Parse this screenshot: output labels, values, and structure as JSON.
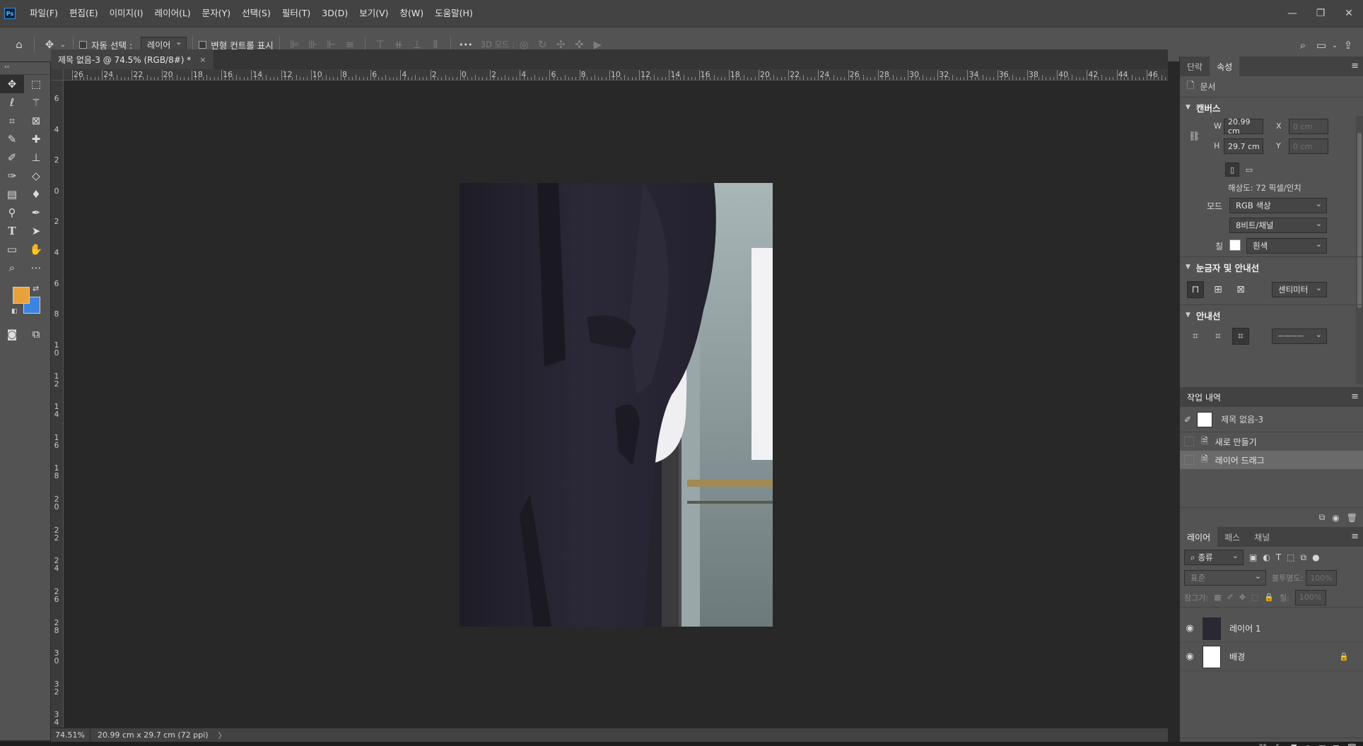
{
  "menubar": {
    "logo": "Ps",
    "items": [
      "파일(F)",
      "편집(E)",
      "이미지(I)",
      "레이어(L)",
      "문자(Y)",
      "선택(S)",
      "필터(T)",
      "3D(D)",
      "보기(V)",
      "창(W)",
      "도움말(H)"
    ],
    "window_controls": [
      "—",
      "❐",
      "✕"
    ]
  },
  "options": {
    "auto_select_label": "자동 선택 :",
    "auto_select_value": "레이어",
    "transform_label": "변형 컨트롤 표시",
    "more_label": "•••",
    "mode3d_label": "3D 모드 :"
  },
  "document": {
    "tab_title": "제목 없음-3 @ 74.5% (RGB/8#) *",
    "tab_close": "×",
    "image_note": ""
  },
  "ruler": {
    "h_labels": [
      "26",
      "24",
      "22",
      "20",
      "18",
      "16",
      "14",
      "12",
      "10",
      "8",
      "6",
      "4",
      "2",
      "0",
      "2",
      "4",
      "6",
      "8",
      "10",
      "12",
      "14",
      "16",
      "18",
      "20",
      "22",
      "24",
      "26",
      "28",
      "30",
      "32",
      "34",
      "36",
      "38",
      "40",
      "42",
      "44",
      "46"
    ],
    "v_labels": [
      "6",
      "4",
      "2",
      "0",
      "2",
      "4",
      "6",
      "8",
      "10",
      "12",
      "14",
      "16",
      "18",
      "20",
      "22",
      "24",
      "26",
      "28",
      "30",
      "32",
      "34"
    ]
  },
  "status": {
    "zoom": "74.51%",
    "info": "20.99 cm x 29.7 cm (72 ppi)",
    "arrow": "〉"
  },
  "properties": {
    "tabs": [
      "단락",
      "속성"
    ],
    "doc_label": "문서",
    "canvas_head": "캔버스",
    "w_label": "W",
    "w_value": "20.99 cm",
    "h_label": "H",
    "h_value": "29.7 cm",
    "x_label": "X",
    "x_placeholder": "0 cm",
    "y_label": "Y",
    "y_placeholder": "0 cm",
    "resolution": "해상도: 72 픽셀/인치",
    "mode_label": "모드",
    "mode_value": "RGB 색상",
    "depth_value": "8비트/채널",
    "fill_label": "칠",
    "fill_value": "흰색",
    "rulers_head": "눈금자 및 안내선",
    "units_value": "센티미터",
    "guides_head": "안내선",
    "guide_line_value": "————"
  },
  "history": {
    "tab": "작업 내역",
    "snapshot": "제목 없음-3",
    "items": [
      "새로 만들기",
      "레이어 드래그"
    ]
  },
  "layers": {
    "tabs": [
      "레이어",
      "패스",
      "채널"
    ],
    "filter_value": "종류",
    "blend_value": "표준",
    "opacity_label": "불투명도:",
    "opacity_value": "100%",
    "lock_label": "잠그기:",
    "fill_label": "칠:",
    "fill_value": "100%",
    "items": [
      {
        "name": "레이어 1"
      },
      {
        "name": "배경"
      }
    ]
  },
  "colors": {
    "foreground": "#e8a23c",
    "background": "#3c84e0"
  }
}
